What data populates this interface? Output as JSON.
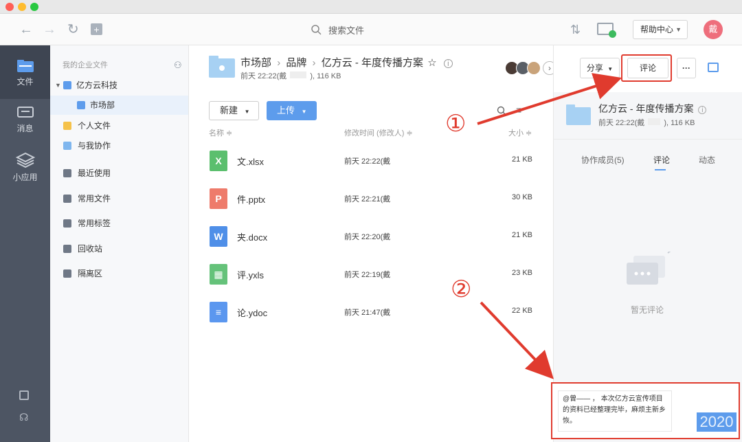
{
  "titlebar": {
    "dots": [
      "#ff5f57",
      "#febc2e",
      "#28c840"
    ]
  },
  "toolbar": {
    "search_placeholder": "搜索文件",
    "help_label": "帮助中心",
    "avatar_char": "戴"
  },
  "leftnav": {
    "items": [
      {
        "label": "文件",
        "icon": "folder-icon"
      },
      {
        "label": "消息",
        "icon": "message-icon"
      },
      {
        "label": "小应用",
        "icon": "cube-icon"
      }
    ]
  },
  "tree": {
    "header": "我的企业文件",
    "company": "亿方云科技",
    "dept": "市场部",
    "items": [
      "个人文件",
      "与我协作",
      "最近使用",
      "常用文件",
      "常用标签",
      "回收站",
      "隔离区"
    ]
  },
  "main": {
    "crumb1": "市场部",
    "crumb2": "品牌",
    "crumb3": "亿方云 - 年度传播方案",
    "meta_time": "前天 22:22(戴",
    "meta_size": "),   116 KB",
    "new_label": "新建",
    "upload_label": "上传",
    "col_name": "名称 ≑",
    "col_time": "修改时间 (修改人) ≑",
    "col_size": "大小 ≑",
    "files": [
      {
        "name": "文.xlsx",
        "time": "前天 22:22(戴",
        "size": "21 KB",
        "type": "X",
        "color": "#5bbf6e"
      },
      {
        "name": "件.pptx",
        "time": "前天 22:21(戴",
        "size": "30 KB",
        "type": "P",
        "color": "#ee7b6b"
      },
      {
        "name": "夹.docx",
        "time": "前天 22:20(戴",
        "size": "21 KB",
        "type": "W",
        "color": "#4f8fe8"
      },
      {
        "name": "评.yxls",
        "time": "前天 22:19(戴",
        "size": "23 KB",
        "type": "▦",
        "color": "#65c27a"
      },
      {
        "name": "论.ydoc",
        "time": "前天 21:47(戴",
        "size": "22 KB",
        "type": "≡",
        "color": "#5b97ef"
      }
    ]
  },
  "rpanel": {
    "share_label": "分享",
    "comment_label": "评论",
    "more_label": "···",
    "title": "亿方云 - 年度传播方案",
    "meta": "前天 22:22(戴",
    "meta_size": "),   116 KB",
    "tabs": [
      "协作成员(5)",
      "评论",
      "动态"
    ],
    "empty_text": "暂无评论",
    "comment_text": "@曾—— ， 本次亿方云宣传项目的资料已经整理完毕，麻烦主新乡恢。",
    "year_text": "2020"
  },
  "annotations": {
    "marker1": "①",
    "marker2": "②"
  }
}
